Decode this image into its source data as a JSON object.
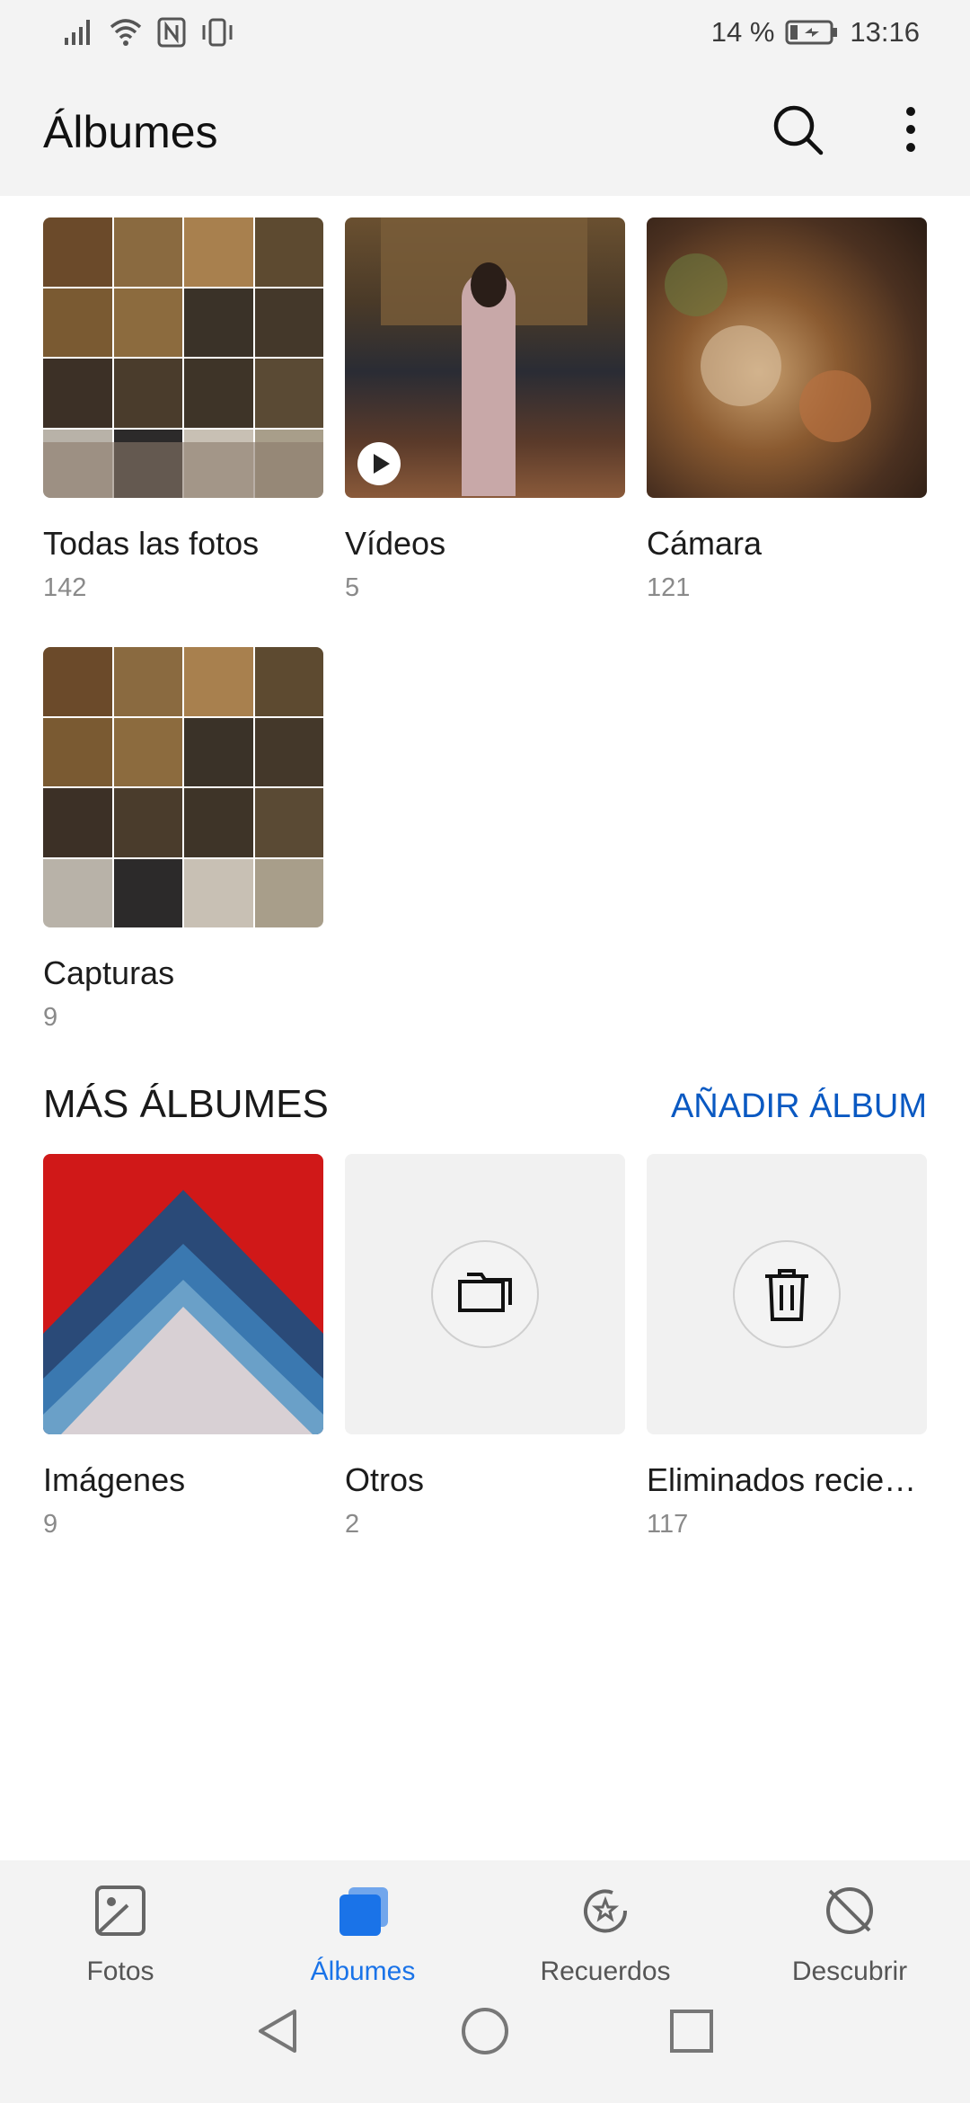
{
  "status_bar": {
    "battery": "14 %",
    "time": "13:16"
  },
  "header": {
    "title": "Álbumes"
  },
  "albums": [
    {
      "name": "Todas las fotos",
      "count": "142"
    },
    {
      "name": "Vídeos",
      "count": "5"
    },
    {
      "name": "Cámara",
      "count": "121"
    },
    {
      "name": "Capturas",
      "count": "9"
    }
  ],
  "more_albums": {
    "title": "MÁS ÁLBUMES",
    "add_label": "AÑADIR ÁLBUM",
    "items": [
      {
        "name": "Imágenes",
        "count": "9"
      },
      {
        "name": "Otros",
        "count": "2"
      },
      {
        "name": "Eliminados recie…",
        "count": "117"
      }
    ]
  },
  "bottom_nav": [
    {
      "label": "Fotos",
      "icon": "photo-icon"
    },
    {
      "label": "Álbumes",
      "icon": "albums-icon",
      "active": true
    },
    {
      "label": "Recuerdos",
      "icon": "memories-icon"
    },
    {
      "label": "Descubrir",
      "icon": "discover-icon"
    }
  ],
  "colors": {
    "accent": "#1a73e8",
    "link": "#0a59c2",
    "bar_bg": "#f3f3f3"
  }
}
